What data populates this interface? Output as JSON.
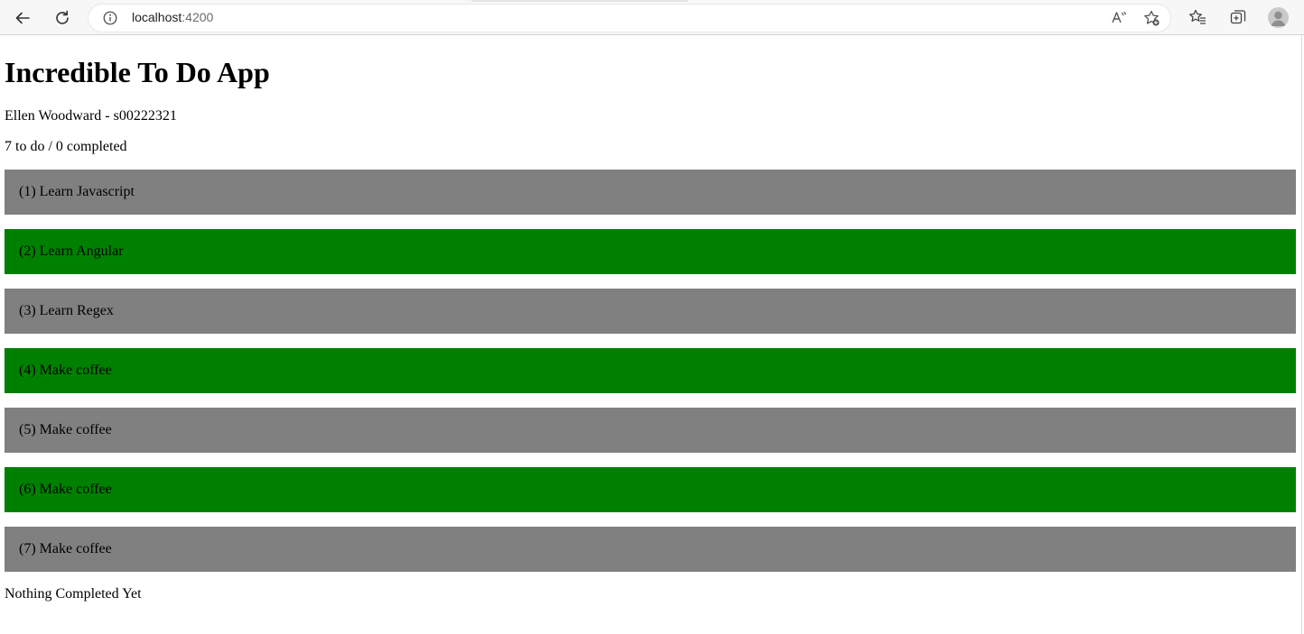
{
  "browser": {
    "url_host": "localhost",
    "url_port": ":4200",
    "icons": {
      "back": "back-arrow-icon",
      "refresh": "refresh-icon",
      "info": "info-icon",
      "read_aloud": "read-aloud-icon",
      "add_favorite": "add-favorite-icon",
      "favorites": "favorites-icon",
      "collections": "collections-icon",
      "profile": "profile-avatar-icon"
    }
  },
  "app": {
    "title": "Incredible To Do App",
    "student": "Ellen Woodward - s00222321",
    "counter": {
      "todo_count": "7",
      "todo_label": "to do",
      "separator": "/",
      "completed_count": "0",
      "completed_label": "completed"
    },
    "todos": [
      {
        "label": "(1) Learn Javascript",
        "color": "#808080"
      },
      {
        "label": "(2) Learn Angular",
        "color": "#008000"
      },
      {
        "label": "(3) Learn Regex",
        "color": "#808080"
      },
      {
        "label": "(4) Make coffee",
        "color": "#008000"
      },
      {
        "label": "(5) Make coffee",
        "color": "#808080"
      },
      {
        "label": "(6) Make coffee",
        "color": "#008000"
      },
      {
        "label": "(7) Make coffee",
        "color": "#808080"
      }
    ],
    "completed_message": "Nothing Completed Yet"
  }
}
